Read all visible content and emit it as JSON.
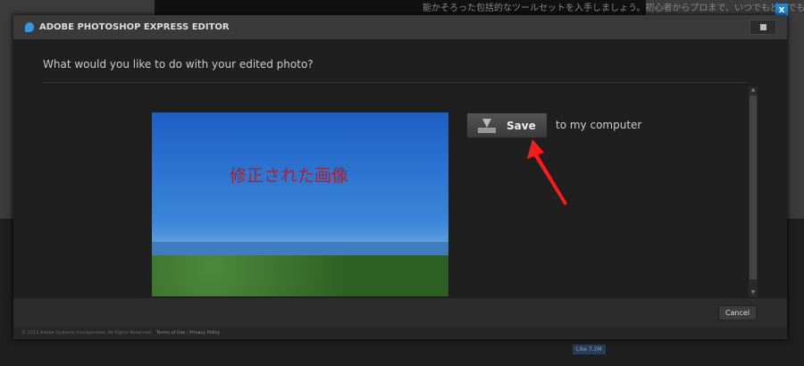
{
  "background": {
    "snippet_text": "能かそろった包括的なツールセットを入手しましょう。初心者からプロまで、いつでもどこでも",
    "like_label": "Like 7.2M"
  },
  "dialog": {
    "title": "ADOBE PHOTOSHOP EXPRESS EDITOR",
    "question": "What would you like to do with your edited photo?",
    "photo_caption": "修正された画像",
    "save_label": "Save",
    "save_suffix": "to my computer",
    "cancel_label": "Cancel",
    "legal": {
      "copyright": "© 2013 Adobe Systems Incorporated. All Rights Reserved.",
      "terms": "Terms of Use",
      "privacy": "Privacy Policy"
    }
  },
  "colors": {
    "accent": "#1e88d8",
    "arrow": "#ff1a1a",
    "caption": "#b01f2a"
  }
}
